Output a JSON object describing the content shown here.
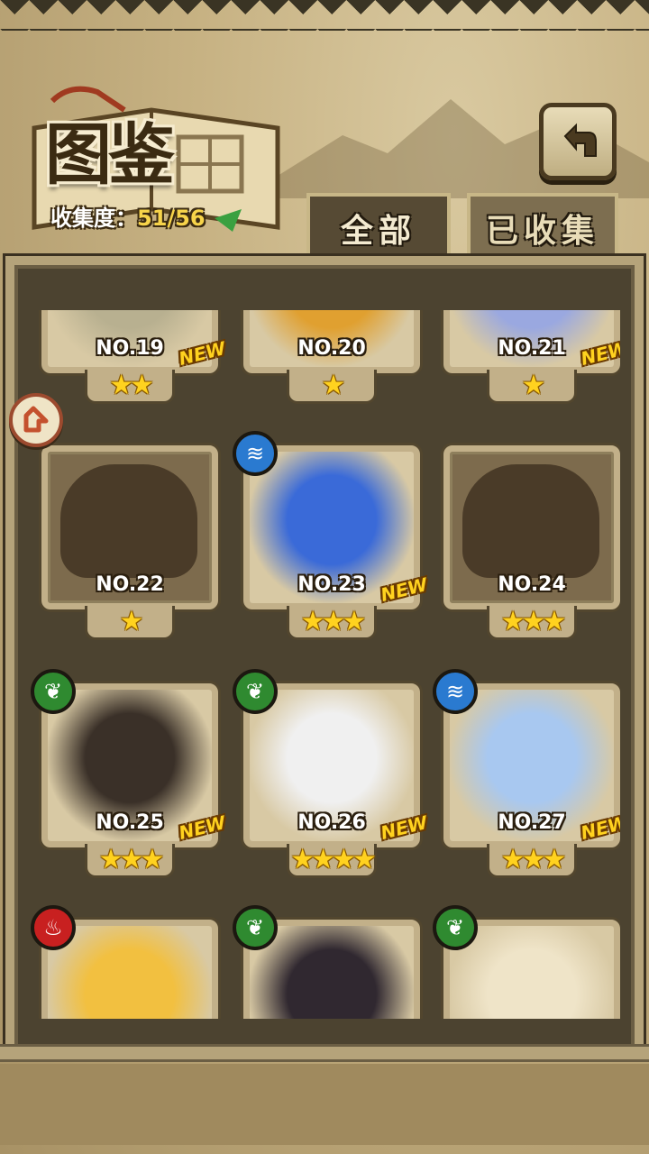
{
  "header": {
    "title": "图鉴",
    "collection_label": "收集度：",
    "collection_value": "51/56"
  },
  "tabs": [
    {
      "label": "全部",
      "active": true
    },
    {
      "label": "已收集",
      "active": false
    }
  ],
  "cards": [
    {
      "number": "NO.19",
      "stars": "★★",
      "new": "NEW",
      "element": "",
      "locked": false,
      "tone": "#b8b090"
    },
    {
      "number": "NO.20",
      "stars": "★",
      "new": "",
      "element": "",
      "locked": false,
      "tone": "#e0a030"
    },
    {
      "number": "NO.21",
      "stars": "★",
      "new": "NEW",
      "element": "",
      "locked": false,
      "tone": "#9aa8e0"
    },
    {
      "number": "NO.22",
      "stars": "★",
      "new": "",
      "element": "",
      "locked": true,
      "tone": "#7d6b4d"
    },
    {
      "number": "NO.23",
      "stars": "★★★",
      "new": "NEW",
      "element": "water",
      "locked": false,
      "tone": "#3a6ad8"
    },
    {
      "number": "NO.24",
      "stars": "★★★",
      "new": "",
      "element": "",
      "locked": true,
      "tone": "#7d6b4d"
    },
    {
      "number": "NO.25",
      "stars": "★★★",
      "new": "NEW",
      "element": "leaf",
      "locked": false,
      "tone": "#3a3028"
    },
    {
      "number": "NO.26",
      "stars": "★★★★",
      "new": "NEW",
      "element": "leaf",
      "locked": false,
      "tone": "#f0f0f0"
    },
    {
      "number": "NO.27",
      "stars": "★★★",
      "new": "NEW",
      "element": "water",
      "locked": false,
      "tone": "#a8c8f0"
    },
    {
      "number": "",
      "stars": "",
      "new": "",
      "element": "fire",
      "locked": false,
      "tone": "#f2c040"
    },
    {
      "number": "",
      "stars": "",
      "new": "",
      "element": "leaf",
      "locked": false,
      "tone": "#302830"
    },
    {
      "number": "",
      "stars": "",
      "new": "",
      "element": "leaf",
      "locked": false,
      "tone": "#efe4c8"
    }
  ],
  "icons": {
    "back": "return-arrow-icon",
    "side": "scroll-indicator-icon"
  },
  "colors": {
    "star": "#ffd21f",
    "new_badge": "#ffd21f",
    "water": "#2a7ad0",
    "leaf": "#2f8a30",
    "fire": "#c82020"
  }
}
